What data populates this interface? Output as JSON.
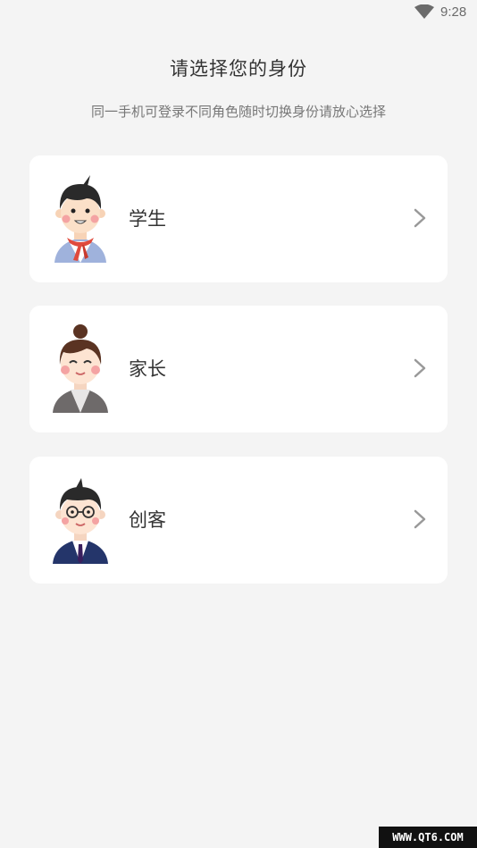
{
  "status_bar": {
    "time": "9:28",
    "wifi_icon": "wifi-icon"
  },
  "header": {
    "title": "请选择您的身份",
    "subtitle": "同一手机可登录不同角色随时切换身份请放心选择"
  },
  "roles": [
    {
      "label": "学生",
      "avatar_icon": "student-avatar-icon"
    },
    {
      "label": "家长",
      "avatar_icon": "parent-avatar-icon"
    },
    {
      "label": "创客",
      "avatar_icon": "maker-avatar-icon"
    }
  ],
  "watermark": "WWW.QT6.COM",
  "colors": {
    "background": "#f4f4f4",
    "card": "#ffffff",
    "chevron": "#999999"
  }
}
